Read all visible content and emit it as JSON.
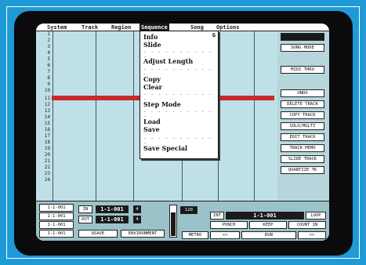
{
  "menubar": {
    "items": [
      "System",
      "Track",
      "Region",
      "Sequence",
      "Song",
      "Options"
    ],
    "active": "Sequence"
  },
  "dropdown": {
    "items": [
      "Info",
      "Slide",
      "Adjust Length",
      "Copy",
      "Clear",
      "Step Mode",
      "Load",
      "Save",
      "Save Special"
    ],
    "badge": "G"
  },
  "tracks": {
    "numbers": [
      "1",
      "2",
      "3",
      "4",
      "5",
      "6",
      "7",
      "8",
      "9",
      "10",
      "11",
      "12",
      "13",
      "14",
      "15",
      "16",
      "17",
      "18",
      "19",
      "20",
      "21",
      "22",
      "23",
      "24"
    ]
  },
  "right_panel": {
    "buttons": [
      "SONG MODE",
      "MIDI THRU",
      "UNDO",
      "DELETE TRACK",
      "COPY TRACK",
      "SOLO/MULTI",
      "EDIT TRACK",
      "TRACK MEMO",
      "SLIDE TRACK",
      "QUANTIZE TK"
    ]
  },
  "transport": {
    "locators": [
      "1-1-001",
      "1-1-001",
      "1-1-001",
      "1-1-001"
    ],
    "in_label": "IN",
    "out_label": "OUT",
    "in_value": "1-1-001",
    "out_value": "1-1-001",
    "ratio_top": "4",
    "ratio_bottom": "4",
    "tempo": "120",
    "qsave": "QSAVE",
    "environment": "ENVIRONMENT",
    "metro": "METRO",
    "position_label": "INT",
    "position": "1-1-001",
    "loop": "LOOP",
    "punch": "PUNCH",
    "keep": "KEEP",
    "count_in": "COUNT IN",
    "rewind": "<<",
    "run": "RUN",
    "forward": ">>"
  }
}
